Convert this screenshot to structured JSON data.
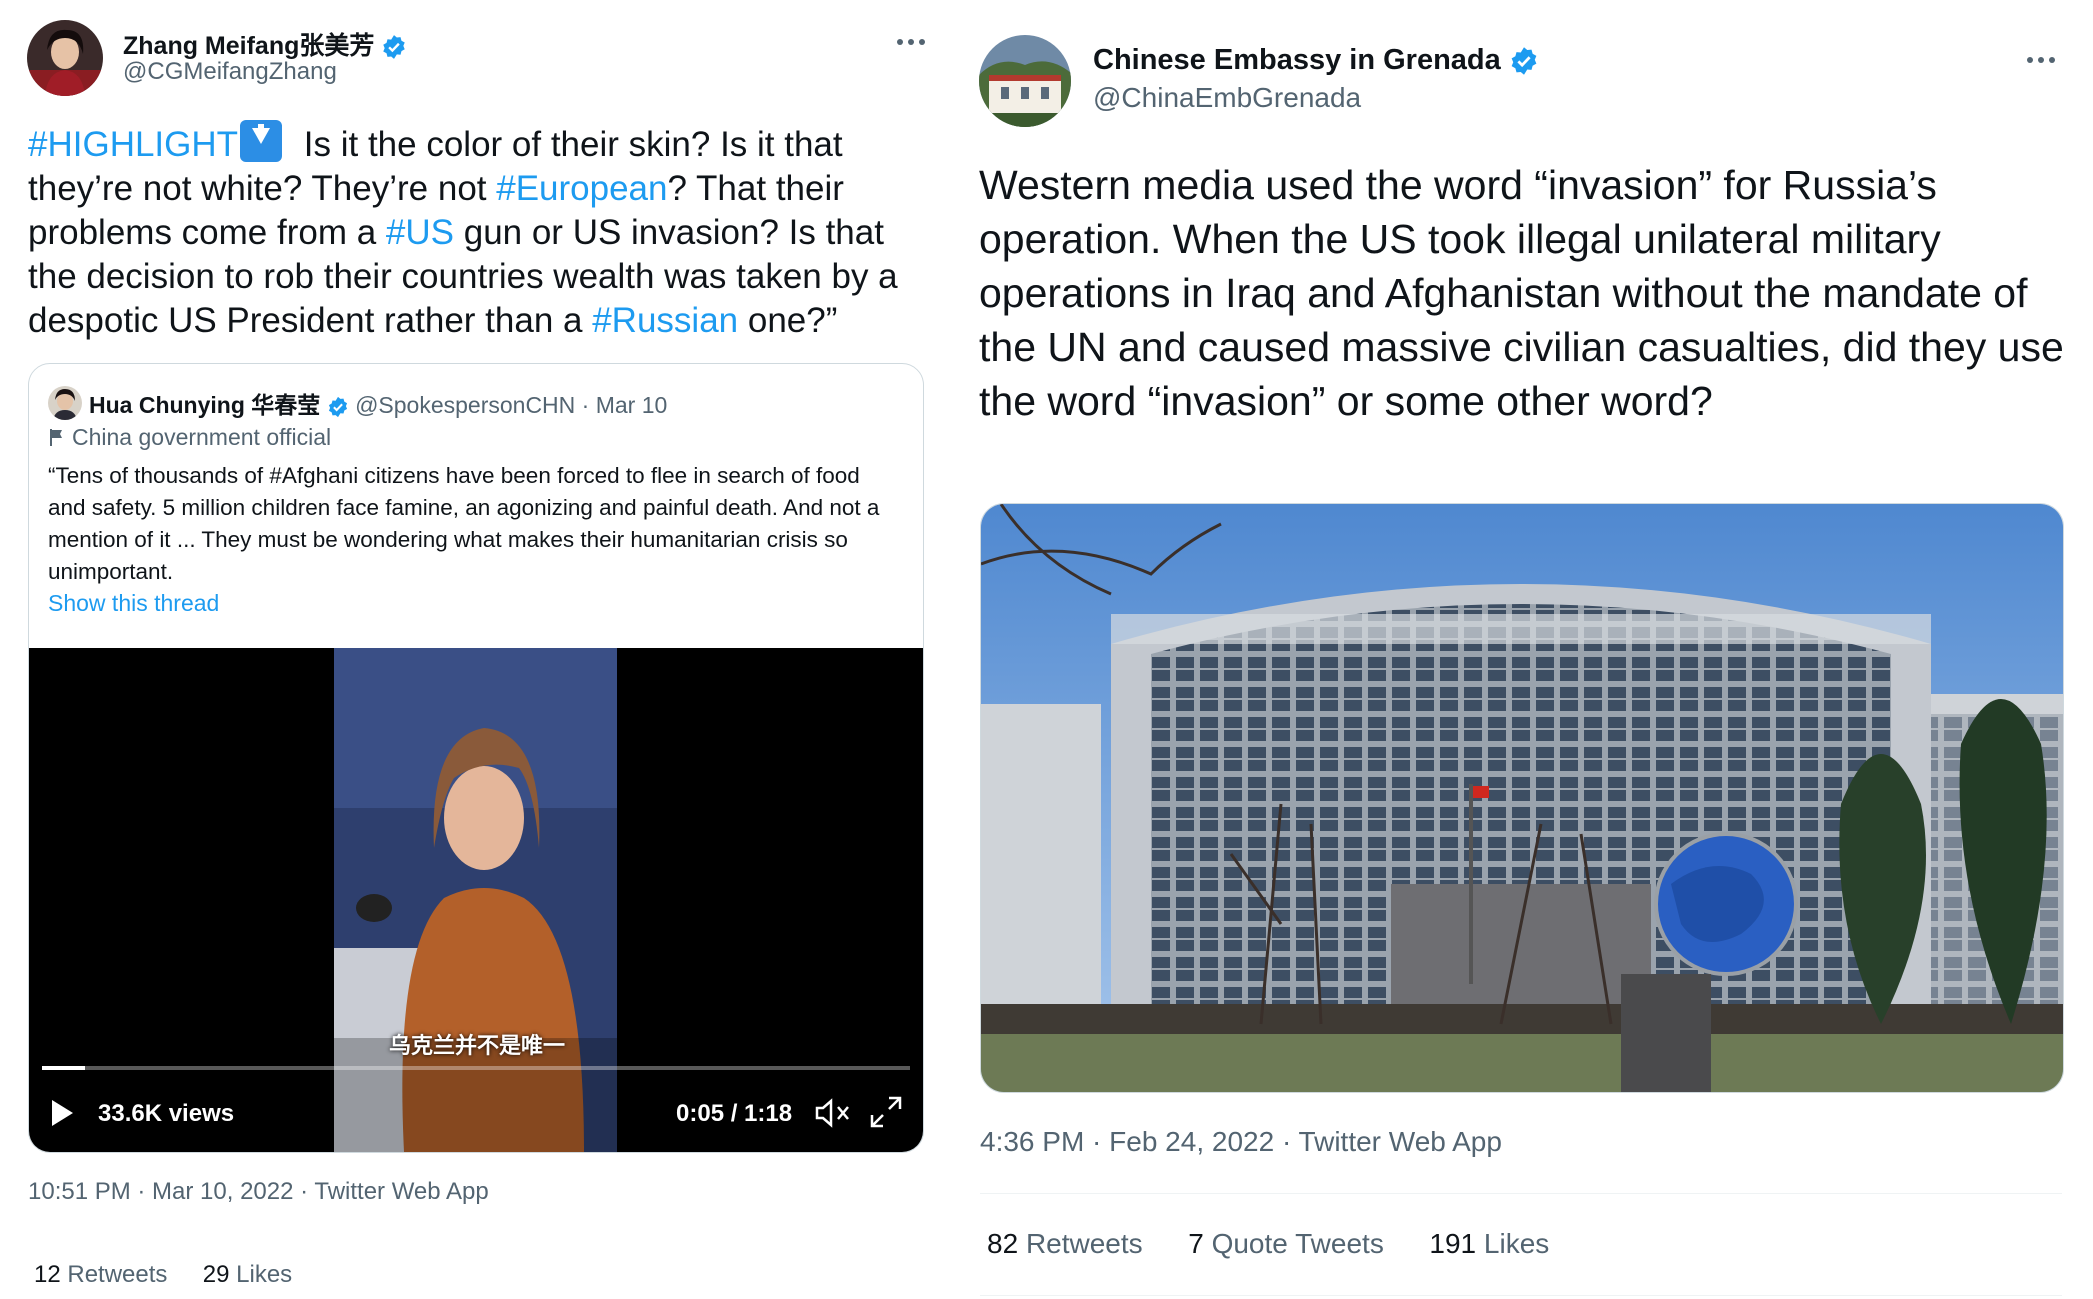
{
  "left_tweet": {
    "author_name": "Zhang Meifang张美芳",
    "author_handle": "@CGMeifangZhang",
    "text_parts": [
      "#HIGHLIGHT",
      " Is it the color of their skin? Is it that they’re not white? They’re not ",
      "#European",
      "? That their problems come from a ",
      "#US",
      " gun or US invasion? Is that the decision to rob their countries wealth was taken by a despotic US President rather than a ",
      "#Russian",
      " one?”"
    ],
    "quoted": {
      "author_name": "Hua Chunying 华春莹",
      "author_handle": "@SpokespersonCHN",
      "date": "· Mar 10",
      "label": "China government official",
      "text": "“Tens of thousands of #Afghani citizens have been forced to flee in search of food and safety. 5 million children face famine, an agonizing and painful death. And not a mention of it ... They must be wondering what makes their humanitarian crisis so unimportant.",
      "show_thread": "Show this thread",
      "video": {
        "subtitle": "乌克兰并不是唯一",
        "views": "33.6K views",
        "time": "0:05 / 1:18",
        "progress": 0.05
      }
    },
    "meta": "10:51 PM · Mar 10, 2022 · Twitter Web App",
    "retweets_count": "12",
    "retweets_label": "Retweets",
    "likes_count": "29",
    "likes_label": "Likes"
  },
  "right_tweet": {
    "author_name": "Chinese Embassy in Grenada",
    "author_handle": "@ChinaEmbGrenada",
    "text": "Western media used the word “invasion” for Russia’s operation. When the US took illegal unilateral military operations in Iraq and Afghanistan without the mandate of the UN and caused massive civilian casualties, did they use the word “invasion” or some other word?",
    "meta": "4:36 PM · Feb 24, 2022 · Twitter Web App",
    "retweets_count": "82",
    "retweets_label": "Retweets",
    "quotes_count": "7",
    "quotes_label": "Quote Tweets",
    "likes_count": "191",
    "likes_label": "Likes"
  },
  "colors": {
    "link": "#1d9bf0",
    "verified": "#1d9bf0",
    "muted": "#536471",
    "text": "#0f1419"
  },
  "icons": [
    "verified-badge-icon",
    "more-options-icon",
    "highlight-down-arrow-icon",
    "government-flag-icon",
    "play-icon",
    "mute-icon",
    "fullscreen-icon"
  ]
}
